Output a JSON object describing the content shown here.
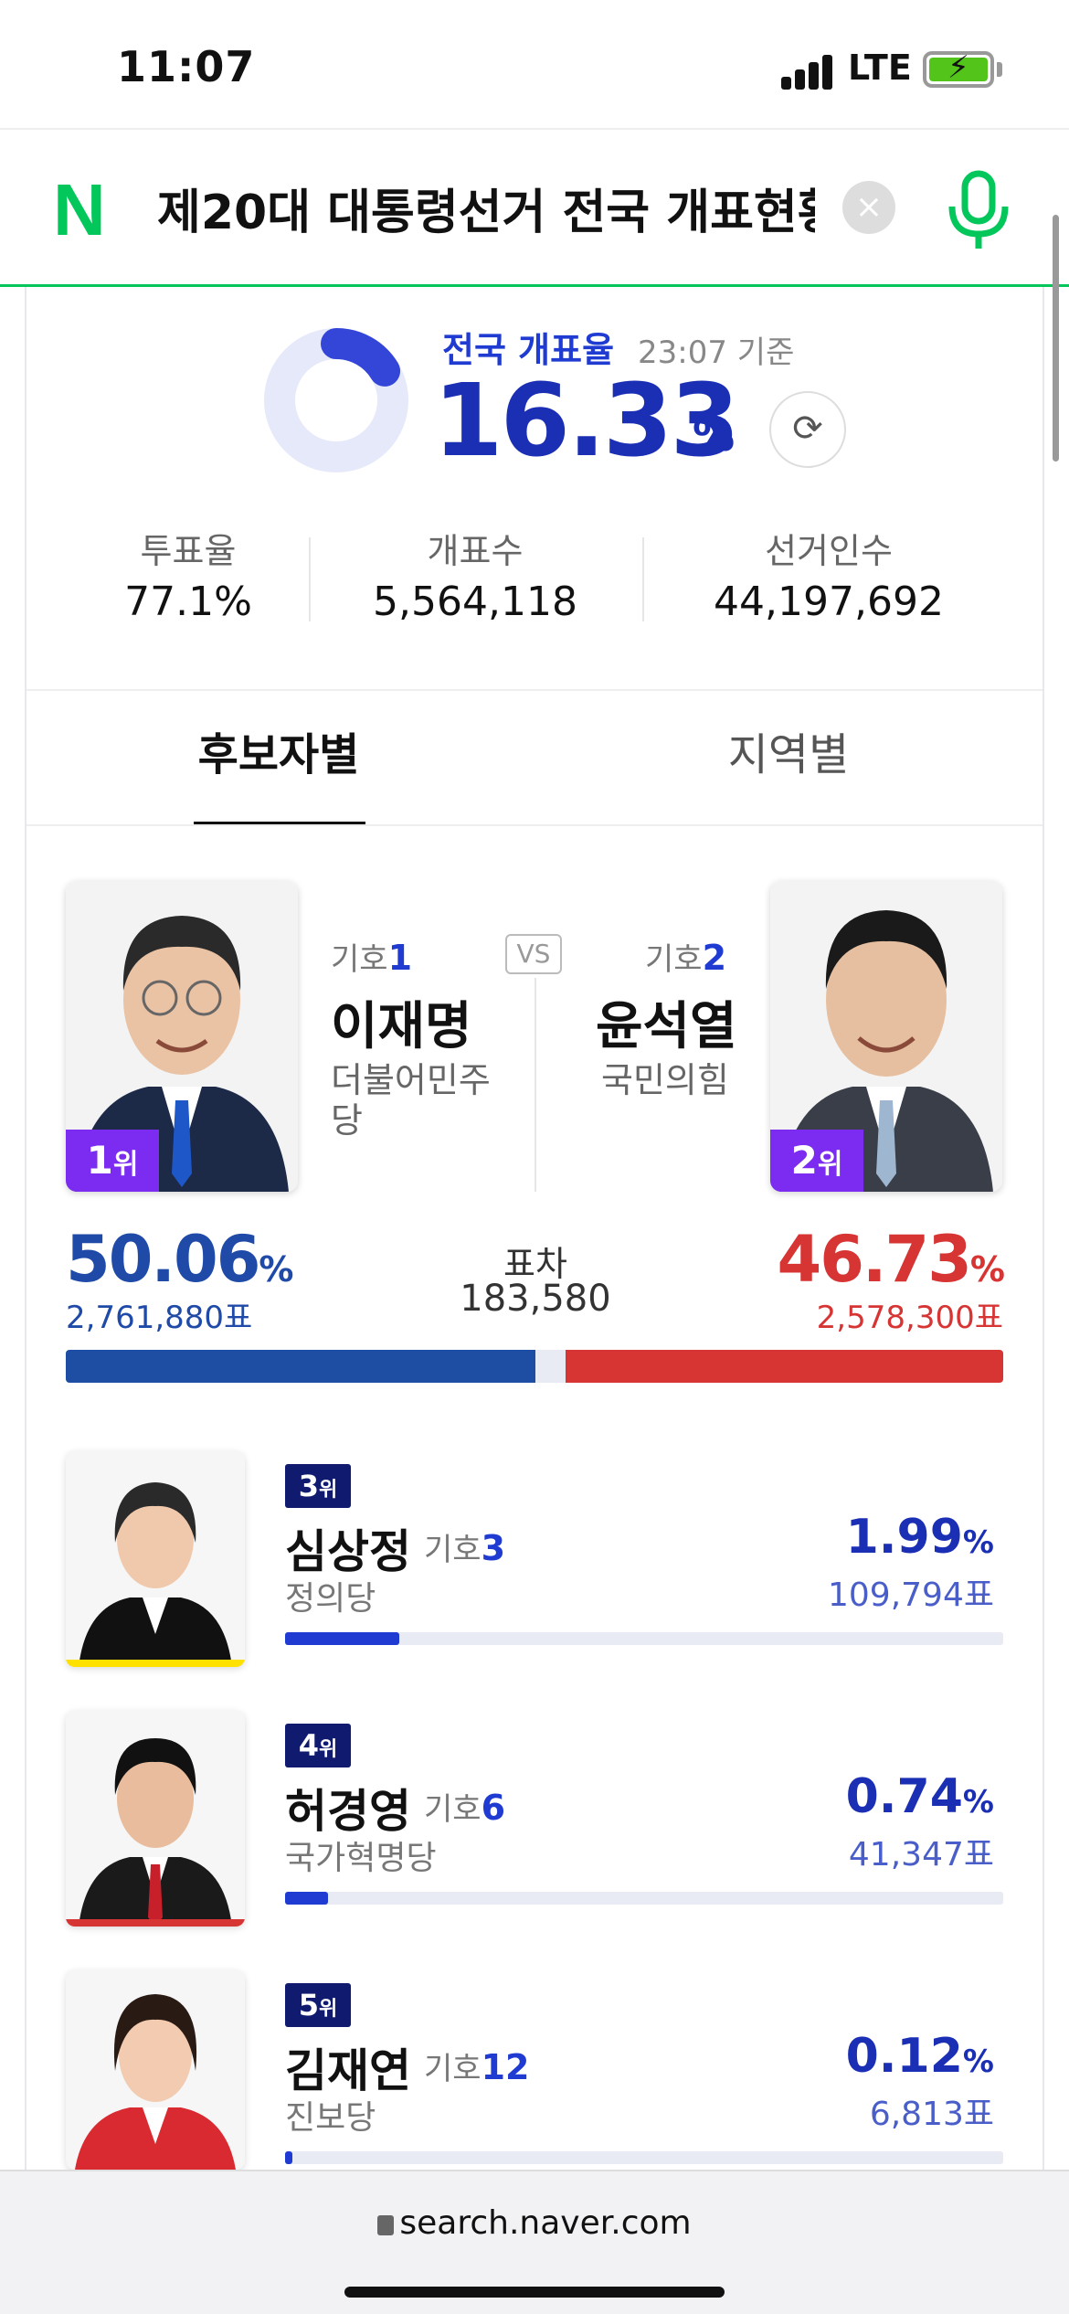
{
  "status_bar": {
    "time": "11:07",
    "network": "LTE"
  },
  "search": {
    "logo": "N",
    "query": "제20대 대통령선거 전국 개표현황"
  },
  "count": {
    "label": "전국 개표율",
    "time": "23:07 기준",
    "rate": "16.33",
    "rate_unit": "%",
    "rate_value": 16.33
  },
  "stats": [
    {
      "label": "투표율",
      "value": "77.1%"
    },
    {
      "label": "개표수",
      "value": "5,564,118"
    },
    {
      "label": "선거인수",
      "value": "44,197,692"
    }
  ],
  "tabs": {
    "active": "후보자별",
    "inactive": "지역별"
  },
  "vs": "VS",
  "top_candidates": {
    "first": {
      "rank": "1",
      "rank_unit": "위",
      "num_label": "기호",
      "num": "1",
      "name": "이재명",
      "party": "더불어민주당",
      "pct": "50.06",
      "votes": "2,761,880표",
      "color": "#1d4ea3"
    },
    "second": {
      "rank": "2",
      "rank_unit": "위",
      "num_label": "기호",
      "num": "2",
      "name": "윤석열",
      "party": "국민의힘",
      "pct": "46.73",
      "votes": "2,578,300표",
      "color": "#d73434"
    },
    "margin_label": "표차",
    "margin_value": "183,580",
    "pct_unit": "%"
  },
  "minor_candidates": [
    {
      "rank": "3",
      "rank_unit": "위",
      "name": "심상정",
      "num_label": "기호",
      "num": "3",
      "party": "정의당",
      "pct": "1.99",
      "pct_unit": "%",
      "votes": "109,794표",
      "stripe": "#ffe100",
      "share": 1.99
    },
    {
      "rank": "4",
      "rank_unit": "위",
      "name": "허경영",
      "num_label": "기호",
      "num": "6",
      "party": "국가혁명당",
      "pct": "0.74",
      "pct_unit": "%",
      "votes": "41,347표",
      "stripe": "#d73434",
      "share": 0.74
    },
    {
      "rank": "5",
      "rank_unit": "위",
      "name": "김재연",
      "num_label": "기호",
      "num": "12",
      "party": "진보당",
      "pct": "0.12",
      "pct_unit": "%",
      "votes": "6,813표",
      "stripe": "#d73434",
      "share": 0.12
    }
  ],
  "url": "search.naver.com",
  "colors": {
    "brand": "#03c75a",
    "accent": "#1b2fb5",
    "rank_badge": "#7b2cf0"
  }
}
